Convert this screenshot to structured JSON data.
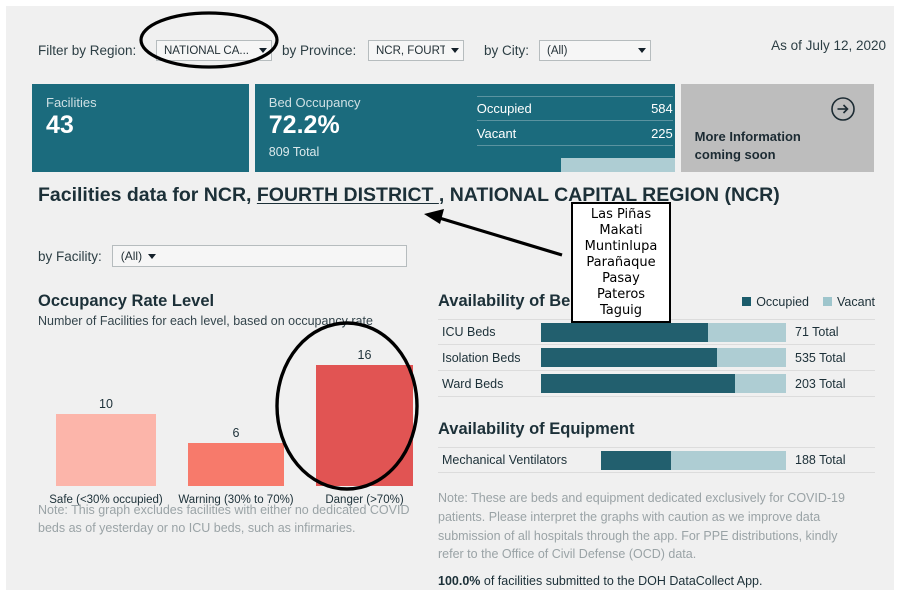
{
  "filters": {
    "region_label": "Filter by Region:",
    "region_value": "NATIONAL CA...",
    "province_label": "by Province:",
    "province_value": "NCR, FOURT...",
    "city_label": "by City:",
    "city_value": "(All)",
    "as_of": "As of July 12, 2020"
  },
  "kpis": {
    "facilities_title": "Facilities",
    "facilities_value": "43",
    "occupancy_title": "Bed Occupancy",
    "occupancy_value": "72.2%",
    "occupancy_total": "809 Total",
    "occupied_label": "Occupied",
    "occupied_value": "584",
    "vacant_label": "Vacant",
    "vacant_value": "225",
    "more_info_line1": "More Information",
    "more_info_line2": "coming soon",
    "more_info_icon": "arrow-right-circle-icon"
  },
  "headline": {
    "prefix": "Facilities data for NCR, ",
    "underlined": "FOURTH DISTRICT ",
    "suffix": ", NATIONAL CAPITAL REGION (NCR)"
  },
  "facility_filter": {
    "label": "by Facility:",
    "value": "(All)"
  },
  "city_tooltip": {
    "cities": [
      "Las Piñas",
      "Makati",
      "Muntinlupa",
      "Parañaque",
      "Pasay",
      "Pateros",
      "Taguig"
    ]
  },
  "occupancy_section": {
    "title": "Occupancy Rate Level",
    "subtitle": "Number of Facilities for each level, based on occupancy rate",
    "note": "Note: This graph excludes facilities with either no dedicated COVID beds as of yesterday or no ICU beds, such as infirmaries."
  },
  "beds_section": {
    "title": "Availability of Beds",
    "legend": [
      {
        "label": "Occupied",
        "color": "#1b5c6b",
        "icon": "legend-swatch-occupied"
      },
      {
        "label": "Vacant",
        "color": "#9ec5cc",
        "icon": "legend-swatch-vacant"
      }
    ]
  },
  "equipment_section": {
    "title": "Availability of Equipment"
  },
  "right_note": {
    "text": "Note: These are beds and equipment dedicated exclusively for COVID-19 patients. Please interpret the graphs with caution as we improve data submission of all hospitals through the app. For PPE distributions, kindly refer to the Office of Civil Defense (OCD) data.",
    "pct": "100.0%",
    "pct_rest": " of facilities submitted to the DOH DataCollect App."
  },
  "chart_data": [
    {
      "type": "bar",
      "title": "Occupancy Rate Level",
      "subtitle": "Number of Facilities for each level, based on occupancy rate",
      "xlabel": "",
      "ylabel": "Number of Facilities",
      "ylim": [
        0,
        16
      ],
      "grid": false,
      "legend": "none",
      "categories": [
        "Safe (<30% occupied)",
        "Warning (30% to 70%)",
        "Danger (>70%)"
      ],
      "values": [
        10,
        6,
        16
      ],
      "colors": [
        "#fcb5aa",
        "#f77a6b",
        "#e15453"
      ]
    },
    {
      "type": "bar",
      "orientation": "horizontal",
      "stacked": true,
      "title": "Availability of Beds",
      "categories": [
        "ICU Beds",
        "Isolation Beds",
        "Ward Beds"
      ],
      "totals": [
        71,
        535,
        203
      ],
      "total_labels": [
        "71 Total",
        "535 Total",
        "203 Total"
      ],
      "series": [
        {
          "name": "Occupied",
          "color": "#225f6e",
          "values": [
            48,
            385,
            160
          ],
          "pct": [
            68,
            72,
            79
          ]
        },
        {
          "name": "Vacant",
          "color": "#aecdd3",
          "values": [
            23,
            150,
            43
          ],
          "pct": [
            32,
            28,
            21
          ]
        }
      ]
    },
    {
      "type": "bar",
      "orientation": "horizontal",
      "stacked": true,
      "title": "Availability of Equipment",
      "categories": [
        "Mechanical Ventilators"
      ],
      "totals": [
        188
      ],
      "total_labels": [
        "188 Total"
      ],
      "series": [
        {
          "name": "Occupied",
          "color": "#225f6e",
          "values": [
            71
          ],
          "pct": [
            38
          ]
        },
        {
          "name": "Vacant",
          "color": "#aecdd3",
          "values": [
            117
          ],
          "pct": [
            62
          ]
        }
      ]
    }
  ]
}
